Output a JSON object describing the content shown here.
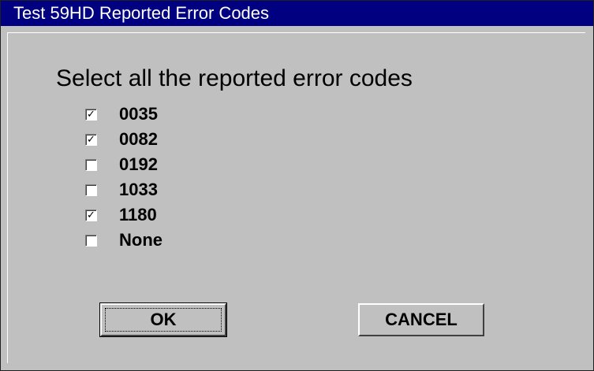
{
  "window": {
    "title": "Test 59HD Reported Error Codes"
  },
  "dialog": {
    "prompt": "Select all the reported error codes",
    "options": [
      {
        "label": "0035",
        "checked": true
      },
      {
        "label": "0082",
        "checked": true
      },
      {
        "label": "0192",
        "checked": false
      },
      {
        "label": "1033",
        "checked": false
      },
      {
        "label": "1180",
        "checked": true
      },
      {
        "label": "None",
        "checked": false
      }
    ]
  },
  "buttons": {
    "ok_label": "OK",
    "cancel_label": "CANCEL"
  },
  "colors": {
    "titlebar": "#000080",
    "background": "#c0c0c0"
  }
}
